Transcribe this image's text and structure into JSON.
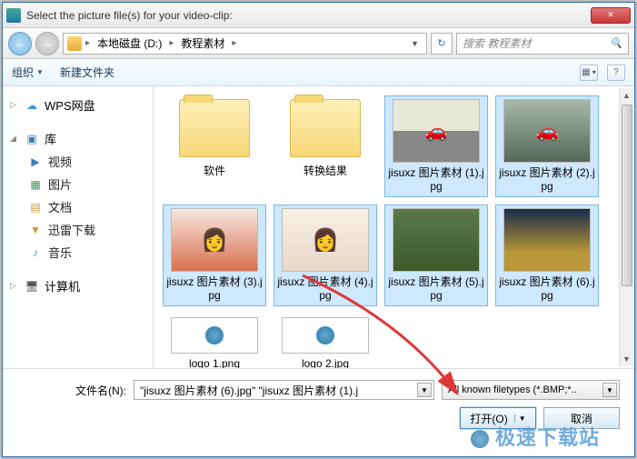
{
  "title": "Select the picture file(s) for your video-clip:",
  "breadcrumb": {
    "drive": "本地磁盘 (D:)",
    "folder": "教程素材"
  },
  "search": {
    "placeholder": "搜索 教程素材"
  },
  "toolbar": {
    "organize": "组织",
    "newfolder": "新建文件夹"
  },
  "sidebar": {
    "wps": "WPS网盘",
    "lib": "库",
    "video": "视频",
    "pic": "图片",
    "doc": "文档",
    "xunlei": "迅雷下载",
    "music": "音乐",
    "computer": "计算机"
  },
  "files": {
    "f0": "软件",
    "f1": "转换结果",
    "f2": "jisuxz 图片素材 (1).jpg",
    "f3": "jisuxz 图片素材 (2).jpg",
    "f4": "jisuxz 图片素材 (3).jpg",
    "f5": "jisuxz 图片素材 (4).jpg",
    "f6": "jisuxz 图片素材 (5).jpg",
    "f7": "jisuxz 图片素材 (6).jpg",
    "f8": "logo 1.png",
    "f9": "logo 2.jpg"
  },
  "bottom": {
    "filename_label": "文件名(N):",
    "filename_value": "\"jisuxz 图片素材 (6).jpg\" \"jisuxz 图片素材 (1).j",
    "filetype": "All known filetypes (*.BMP;*..",
    "open": "打开(O)",
    "cancel": "取消"
  },
  "watermark": "极速下载站"
}
